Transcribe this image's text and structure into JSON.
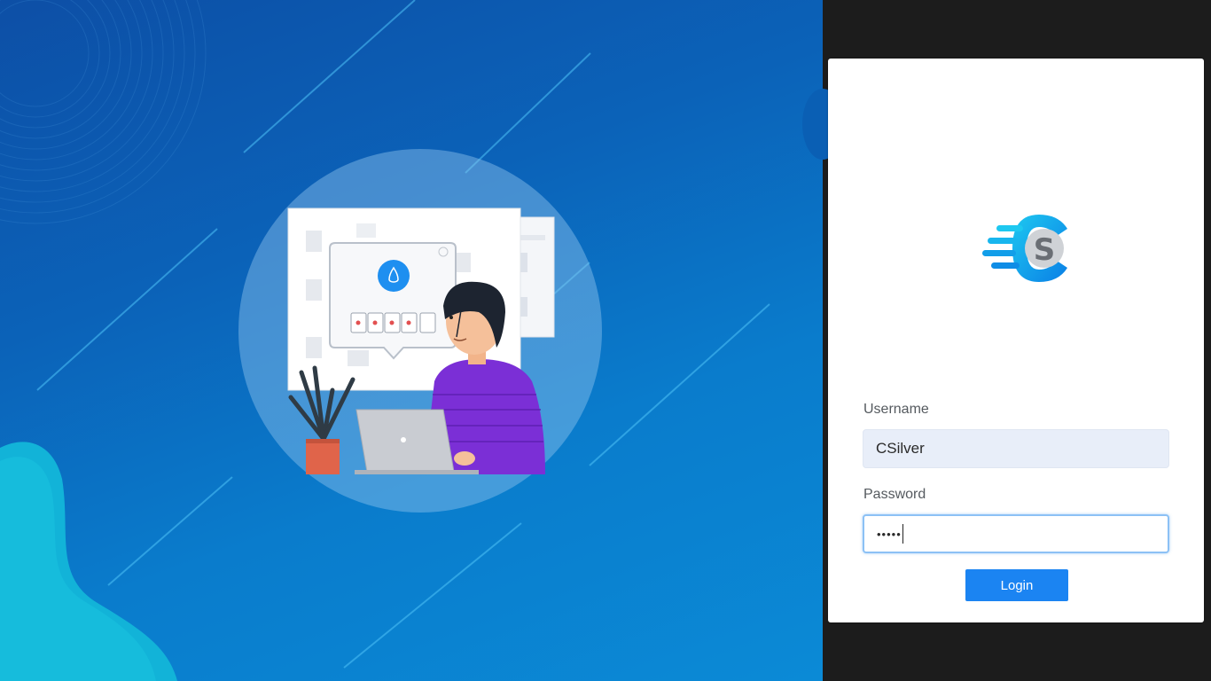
{
  "illustration": {
    "popup_label": "Password"
  },
  "login": {
    "logo_letter": "S",
    "username_label": "Username",
    "username_value": "CSilver",
    "password_label": "Password",
    "password_value": "•••••",
    "button_label": "Login"
  },
  "colors": {
    "accent": "#1b84f2",
    "hero_blue": "#0b62b8",
    "shirt_purple": "#7b2fd6",
    "pot_orange": "#e0644a"
  }
}
